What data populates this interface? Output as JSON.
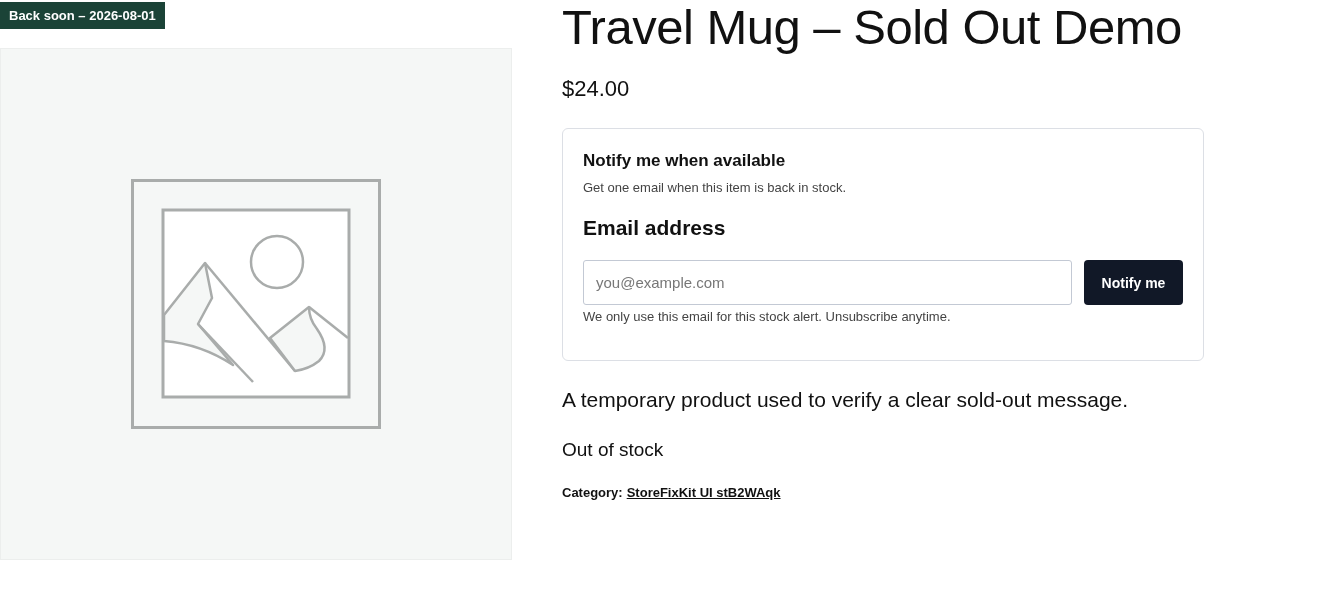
{
  "badge": {
    "text": "Back soon – 2026-08-01"
  },
  "product": {
    "title": "Travel Mug – Sold Out Demo",
    "price": "$24.00"
  },
  "notify_form": {
    "heading": "Notify me when available",
    "subtext": "Get one email when this item is back in stock.",
    "email_label": "Email address",
    "email_field": {
      "placeholder": "you@example.com"
    },
    "button": "Notify me",
    "note": "We only use this email for this stock alert. Unsubscribe anytime."
  },
  "description": "A temporary product used to verify a clear sold-out message.",
  "stock_status": "Out of stock",
  "category": {
    "label": "Category:",
    "link": "StoreFixKit UI stB2WAqk"
  }
}
